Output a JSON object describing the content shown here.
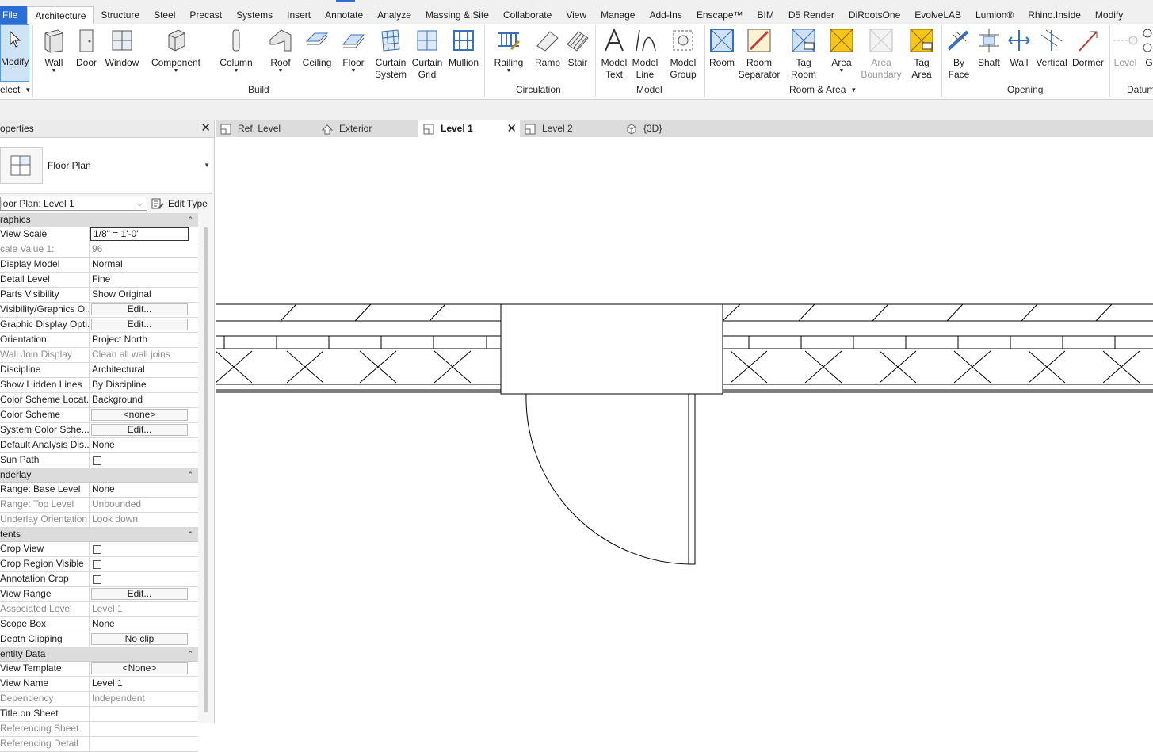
{
  "menu": {
    "items": [
      "File",
      "Architecture",
      "Structure",
      "Steel",
      "Precast",
      "Systems",
      "Insert",
      "Annotate",
      "Analyze",
      "Massing & Site",
      "Collaborate",
      "View",
      "Manage",
      "Add-Ins",
      "Enscape™",
      "BIM",
      "D5 Render",
      "DiRootsOne",
      "EvolveLAB",
      "Lumion®",
      "Rhino.Inside",
      "Modify"
    ],
    "active": "Architecture"
  },
  "ribbon": {
    "select": {
      "modify": "Modify",
      "select": "elect"
    },
    "build": {
      "wall": "Wall",
      "door": "Door",
      "window": "Window",
      "component": "Component",
      "column": "Column",
      "roof": "Roof",
      "ceiling": "Ceiling",
      "floor": "Floor",
      "curtain_system": [
        "Curtain",
        "System"
      ],
      "curtain_grid": [
        "Curtain",
        "Grid"
      ],
      "mullion": "Mullion",
      "label": "Build"
    },
    "circulation": {
      "railing": "Railing",
      "ramp": "Ramp",
      "stair": "Stair",
      "label": "Circulation"
    },
    "model": {
      "model_text": [
        "Model",
        "Text"
      ],
      "model_line": [
        "Model",
        "Line"
      ],
      "model_group": [
        "Model",
        "Group"
      ],
      "label": "Model"
    },
    "room_area": {
      "room": "Room",
      "room_separator": [
        "Room",
        "Separator"
      ],
      "tag_room": [
        "Tag",
        "Room"
      ],
      "area": "Area",
      "area_boundary": [
        "Area",
        "Boundary"
      ],
      "tag_area": [
        "Tag",
        "Area"
      ],
      "label": "Room & Area"
    },
    "opening": {
      "by_face": [
        "By",
        "Face"
      ],
      "shaft": "Shaft",
      "wall": "Wall",
      "vertical": "Vertical",
      "dormer": "Dormer",
      "label": "Opening"
    },
    "datum": {
      "level": "Level",
      "grid": "G",
      "label": "Datum"
    }
  },
  "view_tabs": [
    {
      "label": "Ref. Level",
      "active": false
    },
    {
      "label": "Exterior",
      "active": false
    },
    {
      "label": "Level 1",
      "active": true
    },
    {
      "label": "Level 2",
      "active": false
    },
    {
      "label": "{3D}",
      "active": false
    }
  ],
  "properties": {
    "title": "operties",
    "type_name": "Floor Plan",
    "instance": "loor Plan: Level 1",
    "edit_type": "Edit Type",
    "groups": [
      {
        "name": "raphics",
        "rows": [
          {
            "k": "View Scale",
            "v": "1/8\" = 1'-0\"",
            "kind": "input"
          },
          {
            "k": "cale Value    1:",
            "v": "96",
            "kind": "ro"
          },
          {
            "k": "Display Model",
            "v": "Normal"
          },
          {
            "k": "Detail Level",
            "v": "Fine"
          },
          {
            "k": "Parts Visibility",
            "v": "Show Original"
          },
          {
            "k": "Visibility/Graphics O...",
            "v": "Edit...",
            "kind": "btn"
          },
          {
            "k": "Graphic Display Opti...",
            "v": "Edit...",
            "kind": "btn"
          },
          {
            "k": "Orientation",
            "v": "Project North"
          },
          {
            "k": "Wall Join Display",
            "v": "Clean all wall joins",
            "kind": "ro"
          },
          {
            "k": "Discipline",
            "v": "Architectural"
          },
          {
            "k": "Show Hidden Lines",
            "v": "By Discipline"
          },
          {
            "k": "Color Scheme Locat...",
            "v": "Background"
          },
          {
            "k": "Color Scheme",
            "v": "<none>",
            "kind": "btn"
          },
          {
            "k": "System Color Sche...",
            "v": "Edit...",
            "kind": "btn"
          },
          {
            "k": "Default Analysis Dis...",
            "v": "None"
          },
          {
            "k": "Sun Path",
            "v": "",
            "kind": "cb"
          }
        ]
      },
      {
        "name": "nderlay",
        "rows": [
          {
            "k": "Range: Base Level",
            "v": "None"
          },
          {
            "k": "Range: Top Level",
            "v": "Unbounded",
            "kind": "ro"
          },
          {
            "k": "Underlay Orientation",
            "v": "Look down",
            "kind": "ro"
          }
        ]
      },
      {
        "name": "tents",
        "rows": [
          {
            "k": "Crop View",
            "v": "",
            "kind": "cb"
          },
          {
            "k": "Crop Region Visible",
            "v": "",
            "kind": "cb"
          },
          {
            "k": "Annotation Crop",
            "v": "",
            "kind": "cb"
          },
          {
            "k": "View Range",
            "v": "Edit...",
            "kind": "btn"
          },
          {
            "k": "Associated Level",
            "v": "Level 1",
            "kind": "ro"
          },
          {
            "k": "Scope Box",
            "v": "None"
          },
          {
            "k": "Depth Clipping",
            "v": "No clip",
            "kind": "btn"
          }
        ]
      },
      {
        "name": "entity Data",
        "rows": [
          {
            "k": "View Template",
            "v": "<None>",
            "kind": "btn"
          },
          {
            "k": "View Name",
            "v": "Level 1"
          },
          {
            "k": "Dependency",
            "v": "Independent",
            "kind": "ro"
          },
          {
            "k": "Title on Sheet",
            "v": ""
          },
          {
            "k": "Referencing Sheet",
            "v": "",
            "kind": "ro"
          },
          {
            "k": "Referencing Detail",
            "v": "",
            "kind": "ro"
          }
        ]
      }
    ]
  },
  "colors": {
    "accent": "#2a6fd6",
    "ribbon_icon": "#3b6fb6",
    "room_yellow": "#f5c518"
  }
}
